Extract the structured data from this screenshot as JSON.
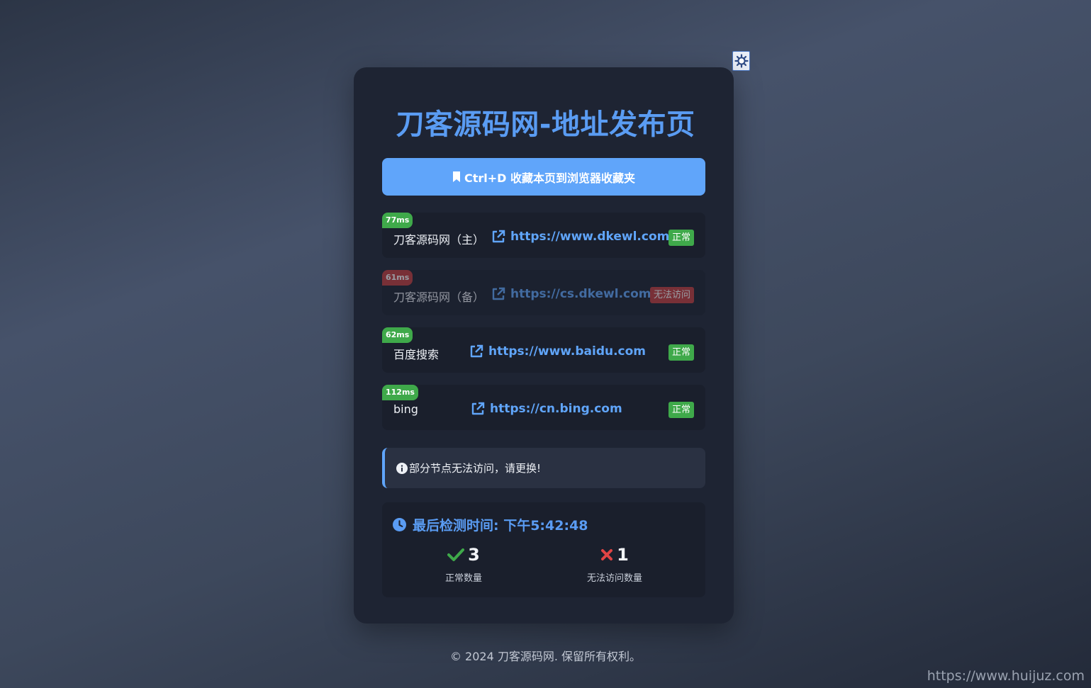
{
  "header": {
    "title": "刀客源码网-地址发布页",
    "theme_toggle_icon": "sun-icon"
  },
  "bookmark": {
    "label": "Ctrl+D 收藏本页到浏览器收藏夹",
    "icon": "bookmark-icon"
  },
  "sites": [
    {
      "latency": "77ms",
      "name": "刀客源码网（主）",
      "url": "https://www.dkewl.com",
      "status": "正常",
      "ok": true
    },
    {
      "latency": "61ms",
      "name": "刀客源码网（备）",
      "url": "https://cs.dkewl.com",
      "status": "无法访问",
      "ok": false
    },
    {
      "latency": "62ms",
      "name": "百度搜索",
      "url": "https://www.baidu.com",
      "status": "正常",
      "ok": true
    },
    {
      "latency": "112ms",
      "name": "bing",
      "url": "https://cn.bing.com",
      "status": "正常",
      "ok": true
    }
  ],
  "notice": {
    "icon": "info-icon",
    "text": "部分节点无法访问，请更换!"
  },
  "stats": {
    "check_time_label": "最后检测时间: 下午5:42:48",
    "ok_count": "3",
    "ok_label": "正常数量",
    "fail_count": "1",
    "fail_label": "无法访问数量"
  },
  "footer": {
    "copyright": "© 2024 刀客源码网. 保留所有权利。"
  },
  "watermark": "https://www.huijuz.com",
  "colors": {
    "accent": "#60a5fa",
    "ok": "#3fa94a",
    "bad": "#c23b3b",
    "card": "#1e2433"
  }
}
